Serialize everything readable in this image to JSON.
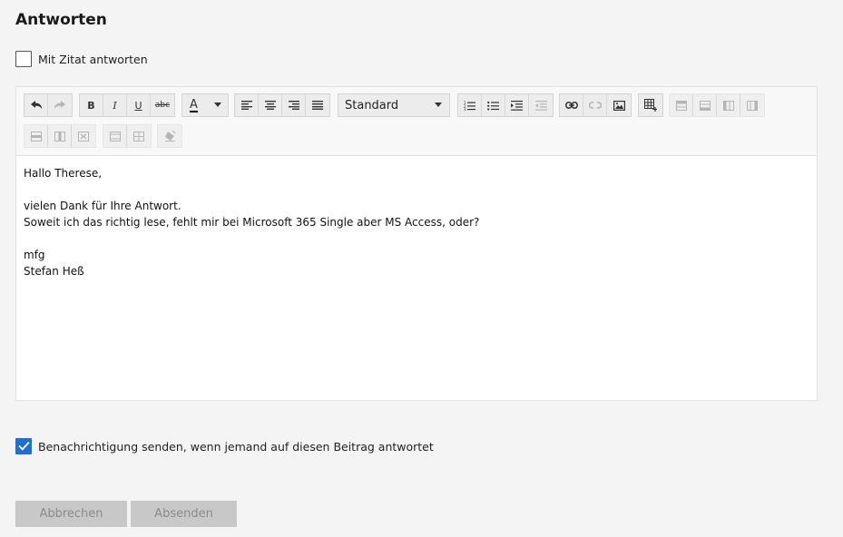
{
  "page_title": "Antworten",
  "quote_option": {
    "label": "Mit Zitat antworten",
    "checked": false
  },
  "toolbar": {
    "style_select": "Standard",
    "icons": [
      "undo-icon",
      "redo-icon",
      "bold-icon",
      "italic-icon",
      "underline-icon",
      "strikethrough-icon",
      "text-color-icon",
      "align-left-icon",
      "align-center-icon",
      "align-right-icon",
      "align-justify-icon",
      "ordered-list-icon",
      "bullet-list-icon",
      "indent-icon",
      "outdent-icon",
      "link-icon",
      "unlink-icon",
      "image-icon",
      "table-icon",
      "row-above-icon",
      "row-below-icon",
      "col-left-icon",
      "col-right-icon",
      "delete-row-icon",
      "delete-col-icon",
      "delete-table-icon",
      "merge-cells-icon",
      "split-cells-icon",
      "clear-format-icon"
    ],
    "bold": "B",
    "italic": "I",
    "underline": "U",
    "strike": "abc",
    "text_color": "A"
  },
  "message_lines": [
    "Hallo Therese,",
    "",
    "vielen Dank für Ihre Antwort.",
    "Soweit ich das richtig lese, fehlt mir bei Microsoft 365 Single aber MS Access, oder?",
    "",
    "mfg",
    "Stefan Heß"
  ],
  "notify_option": {
    "label": "Benachrichtigung senden, wenn jemand auf diesen Beitrag antwortet",
    "checked": true
  },
  "buttons": {
    "cancel": "Abbrechen",
    "submit": "Absenden"
  },
  "colors": {
    "accent": "#1e6fd0",
    "button_disabled_bg": "#c8c8c8",
    "button_disabled_text": "#8a8a8a"
  }
}
